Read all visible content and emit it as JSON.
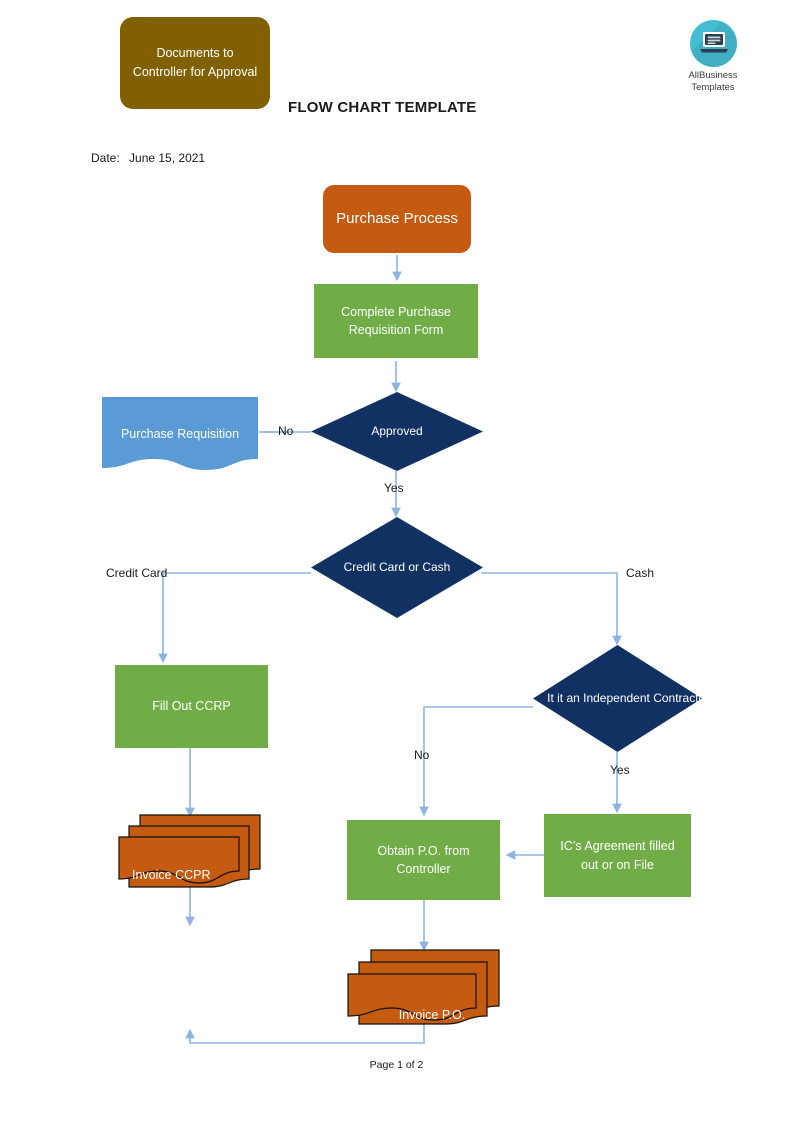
{
  "document": {
    "title": "FLOW CHART TEMPLATE",
    "date_label": "Date:",
    "date_value": "June 15, 2021",
    "footer": "Page 1 of 2"
  },
  "brand": {
    "logo_line1": "AllBusiness",
    "logo_line2": "Templates",
    "logo_icon": "laptop-icon",
    "logo_color": "#45bcd2"
  },
  "colors": {
    "brown": "#806000",
    "orange": "#c55a11",
    "green": "#70ad47",
    "navy": "#123163",
    "doc_blue": "#5b9bd5",
    "connector": "#8eb4e3"
  },
  "notes": {
    "approval_note": "Documents to Controller for Approval"
  },
  "chart_data": {
    "type": "diagram",
    "title": "FLOW CHART TEMPLATE",
    "nodes": [
      {
        "id": "n1",
        "label": "Purchase Process",
        "shape": "rounded-rectangle",
        "color": "#c55a11"
      },
      {
        "id": "n2",
        "label": "Complete Purchase Requisition Form",
        "shape": "rectangle",
        "color": "#70ad47"
      },
      {
        "id": "n3",
        "label": "Approved",
        "shape": "diamond",
        "color": "#123163"
      },
      {
        "id": "n4",
        "label": "Purchase Requisition",
        "shape": "document",
        "color": "#5b9bd5"
      },
      {
        "id": "n5",
        "label": "Credit Card or Cash",
        "shape": "diamond",
        "color": "#123163"
      },
      {
        "id": "n6",
        "label": "Fill Out CCRP",
        "shape": "rectangle",
        "color": "#70ad47"
      },
      {
        "id": "n7",
        "label": "Invoice CCPR",
        "shape": "multi-document",
        "color": "#c55a11"
      },
      {
        "id": "n8",
        "label": "It it an Independent Contractor?",
        "shape": "diamond",
        "color": "#123163"
      },
      {
        "id": "n9",
        "label": "IC’s Agreement filled out or on File",
        "shape": "rectangle",
        "color": "#70ad47"
      },
      {
        "id": "n10",
        "label": "Obtain P.O. from Controller",
        "shape": "rectangle",
        "color": "#70ad47"
      },
      {
        "id": "n11",
        "label": "Invoice P.O.",
        "shape": "multi-document",
        "color": "#c55a11"
      }
    ],
    "edges": [
      {
        "from": "n1",
        "to": "n2",
        "label": ""
      },
      {
        "from": "n2",
        "to": "n3",
        "label": ""
      },
      {
        "from": "n3",
        "to": "n4",
        "label": "No"
      },
      {
        "from": "n3",
        "to": "n5",
        "label": "Yes"
      },
      {
        "from": "n5",
        "to": "n6",
        "label": "Credit Card"
      },
      {
        "from": "n5",
        "to": "n8",
        "label": "Cash"
      },
      {
        "from": "n6",
        "to": "n7",
        "label": ""
      },
      {
        "from": "n8",
        "to": "n10",
        "label": "No"
      },
      {
        "from": "n8",
        "to": "n9",
        "label": "Yes"
      },
      {
        "from": "n9",
        "to": "n10",
        "label": ""
      },
      {
        "from": "n10",
        "to": "n11",
        "label": ""
      },
      {
        "from": "n7",
        "to": "loop",
        "label": ""
      },
      {
        "from": "n11",
        "to": "loop",
        "label": ""
      }
    ]
  },
  "nodes": {
    "purchase_process": "Purchase Process",
    "complete_form": "Complete Purchase Requisition Form",
    "approved": "Approved",
    "purchase_requisition": "Purchase Requisition",
    "credit_card_or_cash": "Credit Card or Cash",
    "fill_out_ccrp": "Fill Out CCRP",
    "invoice_ccpr": "Invoice CCPR",
    "independent_contractor": "It it an Independent Contractor?",
    "ic_agreement": "IC’s Agreement filled out or on File",
    "obtain_po": "Obtain P.O. from Controller",
    "invoice_po": "Invoice P.O."
  },
  "edge_labels": {
    "no_approved": "No",
    "yes_approved": "Yes",
    "credit_card": "Credit Card",
    "cash": "Cash",
    "no_contractor": "No",
    "yes_contractor": "Yes"
  }
}
